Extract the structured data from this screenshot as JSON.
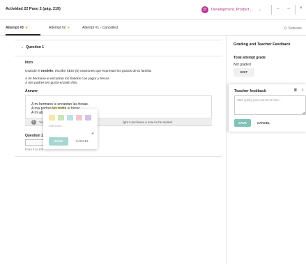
{
  "header": {
    "title": "Actividad 22 Paso 2 (pág. 219)",
    "course_avatar": "D",
    "course_name": "Development, Product ...",
    "course_chevron": "⌄",
    "prev_icon": "←",
    "next_icon": "→",
    "close_icon": "×"
  },
  "tabs": [
    {
      "label": "Attempt #3",
      "star": "★"
    },
    {
      "label": "Attempt #2",
      "star": "★"
    },
    {
      "label": "Attempt #1 - Cancelled",
      "star": ""
    }
  ],
  "statuses_label": "⓪ Statuses",
  "question": {
    "header_chevron": "⌄",
    "header": "Question 1",
    "intro_label": "Intro",
    "instruction_pre": "Usando el ",
    "instruction_bold": "modelo",
    "instruction_post": ", escribe SEIS (6) oraciones que expresan los gustos de tu familia.",
    "example_1": "A mi hermano le encantan los batidos con yogur y fresas.",
    "example_2": "A mis padres les gusta el pollo frito.",
    "answer_label": "Answer",
    "answer_line_1": "A mi hermano le encantan las fresas.",
    "answer_line_2_pre": "A mis padres ",
    "answer_line_2_hl": "les gusta",
    "answer_line_2_post": " el bistec.",
    "answer_line_3": "A mi ab",
    "note_bar_left": "You c",
    "note_bar_right": "light it and leave a note to the student",
    "grade_label": "Question 1",
    "range_text": "From 0 to 100"
  },
  "popover": {
    "swatch_colors": [
      "#f6e8a6",
      "#c9e5b5",
      "#b9e0ec",
      "#f5c6cc",
      "#d3c0e6"
    ],
    "note_placeholder": "Add note...",
    "save_label": "SAVE",
    "cancel_label": "CANCEL"
  },
  "sidebar": {
    "heading": "Grading and Teacher Feedback",
    "total_label": "Total attempt grade",
    "total_value": "Not graded",
    "edit_label": "EDIT"
  },
  "feedback": {
    "title": "Teacher feedback",
    "placeholder": "Start typing your comment here...",
    "save_label": "SAVE",
    "cancel_label": "CANCEL",
    "icon_rich": "Ⅲ",
    "icon_mic": "🎙"
  },
  "colors": {
    "accent": "#7fc2b7",
    "brand": "#b6338f",
    "star": "#f0a93a",
    "highlight": "#f7eaa0"
  }
}
